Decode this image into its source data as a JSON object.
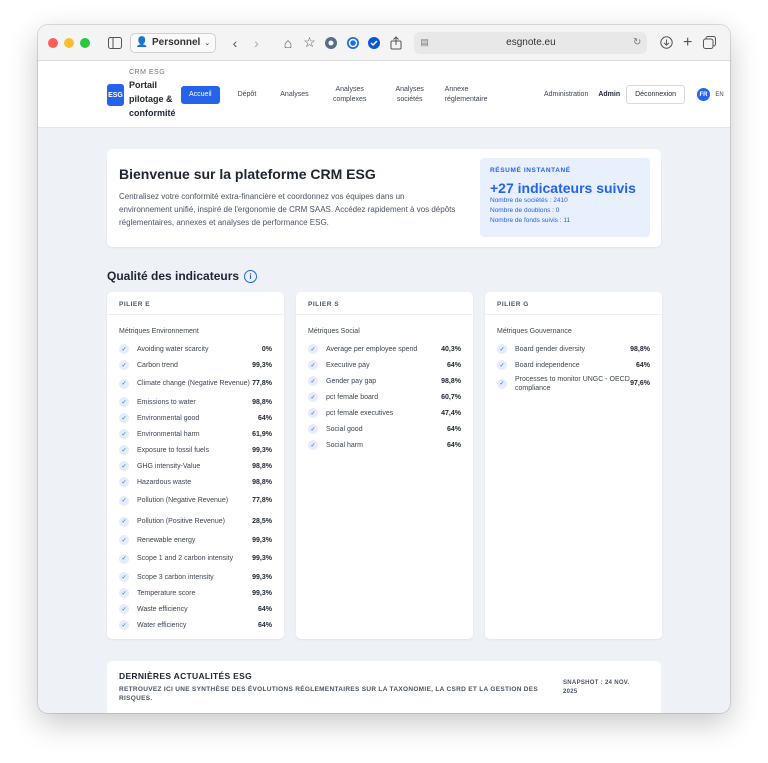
{
  "browser": {
    "profile": "Personnel",
    "url": "esgnote.eu"
  },
  "app": {
    "logo_text": "ESG",
    "brand_sub": "CRM ESG",
    "brand_name": "Portail pilotage & conformité",
    "nav": [
      {
        "label": "Accueil",
        "active": true
      },
      {
        "label": "Dépôt"
      },
      {
        "label": "Analyses"
      },
      {
        "label": "Analyses complexes"
      },
      {
        "label": "Analyses sociétés"
      },
      {
        "label": "Annexe réglementaire"
      },
      {
        "label": "Administration"
      }
    ],
    "user": "Admin",
    "logout": "Déconnexion",
    "lang_fr": "FR",
    "lang_en": "EN"
  },
  "welcome": {
    "title": "Bienvenue sur la plateforme CRM ESG",
    "text": "Centralisez votre conformité extra-financière et coordonnez vos équipes dans un environnement unifié, inspiré de l'ergonomie de CRM SAAS. Accédez rapidement à vos dépôts réglementaires, annexes et analyses de performance ESG."
  },
  "resume": {
    "tag": "RÉSUMÉ INSTANTANÉ",
    "headline": "+27 indicateurs suivis",
    "companies": "Nombre de sociétés : 2410",
    "duplicates": "Nombre de doublons : 0",
    "funds": "Nombre de fonds suivis : 11"
  },
  "quality": {
    "title": "Qualité des indicateurs",
    "pillars": [
      {
        "label": "PILIER E",
        "category": "Métriques Environnement",
        "metrics": [
          {
            "name": "Avoiding water scarcity",
            "value": "0%"
          },
          {
            "name": "Carbon trend",
            "value": "99,3%"
          },
          {
            "name": "Climate change (Negative Revenue)",
            "value": "77,8%"
          },
          {
            "name": "Emissions to water",
            "value": "98,8%"
          },
          {
            "name": "Environmental good",
            "value": "64%"
          },
          {
            "name": "Environmental harm",
            "value": "61,9%"
          },
          {
            "name": "Exposure to fossil fuels",
            "value": "99,3%"
          },
          {
            "name": "GHG intensity-Value",
            "value": "98,8%"
          },
          {
            "name": "Hazardous waste",
            "value": "98,8%"
          },
          {
            "name": "Pollution (Negative Revenue)",
            "value": "77,8%"
          },
          {
            "name": "Pollution (Positive Revenue)",
            "value": "28,5%"
          },
          {
            "name": "Renewable energy",
            "value": "99,3%"
          },
          {
            "name": "Scope 1 and 2 carbon intensity",
            "value": "99,3%"
          },
          {
            "name": "Scope 3 carbon intensity",
            "value": "99,3%"
          },
          {
            "name": "Temperature score",
            "value": "99,3%"
          },
          {
            "name": "Waste efficiency",
            "value": "64%"
          },
          {
            "name": "Water efficiency",
            "value": "64%"
          }
        ]
      },
      {
        "label": "PILIER S",
        "category": "Métriques Social",
        "metrics": [
          {
            "name": "Average per employee spend",
            "value": "40,3%"
          },
          {
            "name": "Executive pay",
            "value": "64%"
          },
          {
            "name": "Gender pay gap",
            "value": "98,8%"
          },
          {
            "name": "pct female board",
            "value": "60,7%"
          },
          {
            "name": "pct female executives",
            "value": "47,4%"
          },
          {
            "name": "Social good",
            "value": "64%"
          },
          {
            "name": "Social harm",
            "value": "64%"
          }
        ]
      },
      {
        "label": "PILIER G",
        "category": "Métriques Gouvernance",
        "metrics": [
          {
            "name": "Board gender diversity",
            "value": "98,8%"
          },
          {
            "name": "Board independence",
            "value": "64%"
          },
          {
            "name": "Processes to monitor UNGC - OECD compliance",
            "value": "97,6%"
          }
        ]
      }
    ]
  },
  "news": {
    "title": "DERNIÈRES ACTUALITÉS ESG",
    "subtitle": "RETROUVEZ ICI UNE SYNTHÈSE DES ÉVOLUTIONS RÉGLEMENTAIRES SUR LA TAXONOMIE, LA CSRD ET LA GESTION DES RISQUES.",
    "snapshot": "SNAPSHOT : 24 NOV. 2025"
  },
  "colors": {
    "accent": "#2563eb",
    "background": "#eef1f5"
  }
}
